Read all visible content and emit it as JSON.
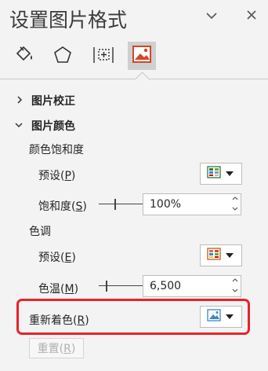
{
  "pane": {
    "title": "设置图片格式"
  },
  "header": {
    "collapse_icon": "chevron-down-icon",
    "close_icon": "close-icon"
  },
  "tabs": [
    {
      "icon": "fill-line-icon",
      "active": false
    },
    {
      "icon": "effects-icon",
      "active": false
    },
    {
      "icon": "size-properties-icon",
      "active": false
    },
    {
      "icon": "picture-icon",
      "active": true
    }
  ],
  "sections": {
    "correction": {
      "label": "图片校正",
      "expanded": false
    },
    "color": {
      "label": "图片颜色",
      "expanded": true
    }
  },
  "saturation": {
    "group_label": "颜色饱和度",
    "preset_label": "预设",
    "preset_key": "P",
    "value_label": "饱和度",
    "value_key": "S",
    "value": "100%",
    "slider_fraction": 0.33
  },
  "tone": {
    "group_label": "色调",
    "preset_label": "预设",
    "preset_key": "E",
    "value_label": "色温",
    "value_key": "M",
    "value": "6,500",
    "slider_fraction": 0.15
  },
  "recolor": {
    "label": "重新着色",
    "key": "R"
  },
  "reset": {
    "label": "重置",
    "key": "R"
  },
  "colors": {
    "highlight": "#e8232a",
    "accent": "#d24726",
    "active_tab": "#cfcfcf"
  }
}
